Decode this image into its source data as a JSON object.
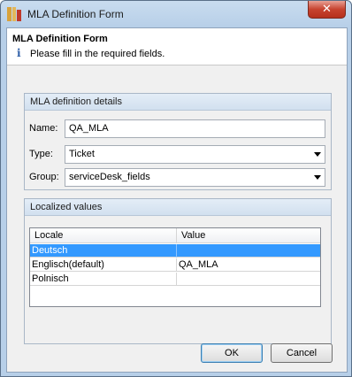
{
  "window": {
    "title": "MLA Definition Form",
    "close_glyph": "✕"
  },
  "header": {
    "title": "MLA Definition Form",
    "message": "Please fill in the required fields.",
    "info_glyph": "i"
  },
  "details": {
    "title": "MLA definition details",
    "name_label": "Name:",
    "name_value": "QA_MLA",
    "type_label": "Type:",
    "type_value": "Ticket",
    "group_label": "Group:",
    "group_value": "serviceDesk_fields"
  },
  "localized": {
    "title": "Localized values",
    "columns": [
      "Locale",
      "Value"
    ],
    "rows": [
      {
        "locale": "Deutsch",
        "value": "",
        "selected": true
      },
      {
        "locale": "Englisch(default)",
        "value": "QA_MLA",
        "selected": false
      },
      {
        "locale": "Polnisch",
        "value": "",
        "selected": false
      }
    ]
  },
  "buttons": {
    "ok": "OK",
    "cancel": "Cancel"
  }
}
